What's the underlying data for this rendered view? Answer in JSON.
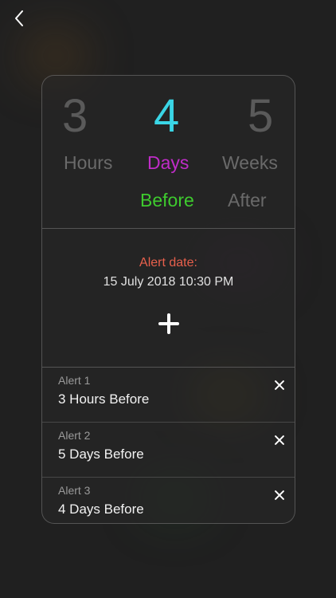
{
  "picker": {
    "numbers": [
      "3",
      "4",
      "5"
    ],
    "units": [
      "Hours",
      "Days",
      "Weeks"
    ],
    "relations": [
      "Before",
      "After"
    ],
    "selected": {
      "number": "4",
      "unit": "Days",
      "relation": "Before"
    }
  },
  "alert": {
    "label": "Alert date:",
    "date": "15 July 2018 10:30 PM"
  },
  "alerts": [
    {
      "title": "Alert 1",
      "value": "3 Hours Before"
    },
    {
      "title": "Alert 2",
      "value": "5 Days Before"
    },
    {
      "title": "Alert 3",
      "value": "4 Days Before"
    }
  ],
  "icons": {
    "back": "chevron-left-icon",
    "add": "plus-icon",
    "remove": "close-icon"
  },
  "colors": {
    "number_selected": "#3ad6e6",
    "unit_selected": "#c02cc8",
    "relation_selected": "#3ecb2e",
    "alert_label": "#e8604c"
  }
}
